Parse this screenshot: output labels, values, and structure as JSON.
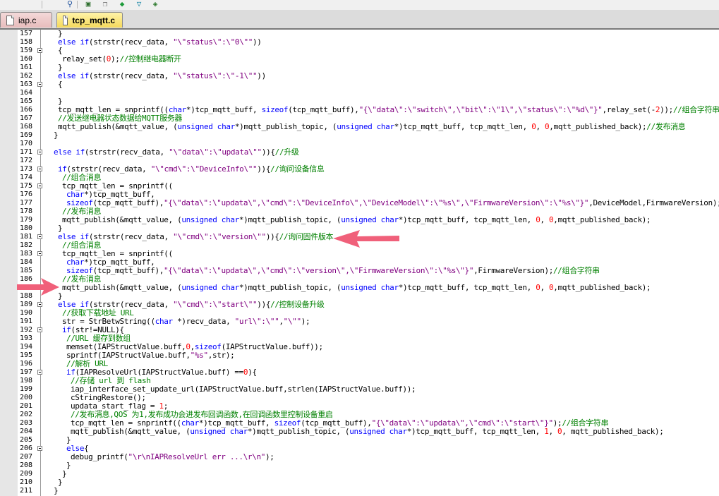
{
  "toolbar": {
    "buttons": [
      {
        "name": "find-in-files-icon",
        "glyph": "⚲"
      },
      {
        "name": "window-icon",
        "glyph": "▣"
      },
      {
        "name": "copy-window-icon",
        "glyph": "❐"
      },
      {
        "name": "diamond-download-icon",
        "glyph": "◆"
      },
      {
        "name": "funnel-icon",
        "glyph": "▽"
      },
      {
        "name": "flow-diagram-icon",
        "glyph": "◈"
      }
    ]
  },
  "tabs": [
    {
      "label": "iap.c",
      "active": false
    },
    {
      "label": "tcp_mqtt.c",
      "active": true
    }
  ],
  "colors": {
    "keyword": "#0000ff",
    "string": "#800080",
    "comment": "#008000",
    "number": "#ff0000",
    "arrow": "#f0607a"
  },
  "editor": {
    "lines": [
      {
        "n": "157",
        "indent": 7,
        "fold": null,
        "segs": [
          [
            "p",
            "}"
          ]
        ]
      },
      {
        "n": "158",
        "indent": 7,
        "fold": null,
        "segs": [
          [
            "k",
            "else if"
          ],
          [
            "p",
            "(strstr(recv_data, "
          ],
          [
            "s",
            "\"\\\"status\\\":\\\"0\\\"\""
          ],
          [
            "p",
            "))"
          ]
        ]
      },
      {
        "n": "159",
        "indent": 7,
        "fold": "open",
        "segs": [
          [
            "p",
            "{"
          ]
        ]
      },
      {
        "n": "160",
        "indent": 8,
        "fold": null,
        "segs": [
          [
            "p",
            "relay_set("
          ],
          [
            "n",
            "0"
          ],
          [
            "p",
            ");"
          ],
          [
            "c",
            "//控制继电器断开"
          ]
        ]
      },
      {
        "n": "161",
        "indent": 7,
        "fold": null,
        "segs": [
          [
            "p",
            "}"
          ]
        ]
      },
      {
        "n": "162",
        "indent": 7,
        "fold": null,
        "segs": [
          [
            "k",
            "else if"
          ],
          [
            "p",
            "(strstr(recv_data, "
          ],
          [
            "s",
            "\"\\\"status\\\":\\\"-1\\\"\""
          ],
          [
            "p",
            "))"
          ]
        ]
      },
      {
        "n": "163",
        "indent": 7,
        "fold": "open",
        "segs": [
          [
            "p",
            "{"
          ]
        ]
      },
      {
        "n": "164",
        "indent": 7,
        "fold": null,
        "segs": []
      },
      {
        "n": "165",
        "indent": 7,
        "fold": null,
        "segs": [
          [
            "p",
            "}"
          ]
        ]
      },
      {
        "n": "166",
        "indent": 7,
        "fold": null,
        "segs": [
          [
            "p",
            "tcp_mqtt_len = snprintf(("
          ],
          [
            "k",
            "char"
          ],
          [
            "p",
            "*)tcp_mqtt_buff, "
          ],
          [
            "k",
            "sizeof"
          ],
          [
            "p",
            "(tcp_mqtt_buff),"
          ],
          [
            "s",
            "\"{\\\"data\\\":\\\"switch\\\",\\\"bit\\\":\\\"1\\\",\\\"status\\\":\\\"%d\\\"}\""
          ],
          [
            "p",
            ",relay_set(-"
          ],
          [
            "n",
            "2"
          ],
          [
            "p",
            "));"
          ],
          [
            "c",
            "//组合字符串"
          ]
        ]
      },
      {
        "n": "167",
        "indent": 7,
        "fold": null,
        "segs": [
          [
            "c",
            "//发送继电器状态数据给MQTT服务器"
          ]
        ]
      },
      {
        "n": "168",
        "indent": 7,
        "fold": null,
        "segs": [
          [
            "p",
            "mqtt_publish(&mqtt_value, ("
          ],
          [
            "k",
            "unsigned char"
          ],
          [
            "p",
            "*)mqtt_publish_topic, ("
          ],
          [
            "k",
            "unsigned char"
          ],
          [
            "p",
            "*)tcp_mqtt_buff, tcp_mqtt_len, "
          ],
          [
            "n",
            "0"
          ],
          [
            "p",
            ", "
          ],
          [
            "n",
            "0"
          ],
          [
            "p",
            ",mqtt_published_back);"
          ],
          [
            "c",
            "//发布消息"
          ]
        ]
      },
      {
        "n": "169",
        "indent": 6,
        "fold": null,
        "segs": [
          [
            "p",
            "}"
          ]
        ]
      },
      {
        "n": "170",
        "indent": 6,
        "fold": null,
        "segs": []
      },
      {
        "n": "171",
        "indent": 6,
        "fold": "open",
        "segs": [
          [
            "k",
            "else if"
          ],
          [
            "p",
            "(strstr(recv_data, "
          ],
          [
            "s",
            "\"\\\"data\\\":\\\"updata\\\"\""
          ],
          [
            "p",
            "))"
          ],
          [
            "p",
            "{"
          ],
          [
            "c",
            "//升级"
          ]
        ]
      },
      {
        "n": "172",
        "indent": 6,
        "fold": null,
        "segs": []
      },
      {
        "n": "173",
        "indent": 7,
        "fold": "open",
        "segs": [
          [
            "k",
            "if"
          ],
          [
            "p",
            "(strstr(recv_data, "
          ],
          [
            "s",
            "\"\\\"cmd\\\":\\\"DeviceInfo\\\"\""
          ],
          [
            "p",
            "))"
          ],
          [
            "p",
            "{"
          ],
          [
            "c",
            "//询问设备信息"
          ]
        ]
      },
      {
        "n": "174",
        "indent": 8,
        "fold": null,
        "segs": [
          [
            "c",
            "//组合消息"
          ]
        ]
      },
      {
        "n": "175",
        "indent": 8,
        "fold": "open",
        "segs": [
          [
            "p",
            "tcp_mqtt_len = snprintf(("
          ]
        ]
      },
      {
        "n": "176",
        "indent": 9,
        "fold": null,
        "segs": [
          [
            "k",
            "char"
          ],
          [
            "p",
            "*)tcp_mqtt_buff,"
          ]
        ]
      },
      {
        "n": "177",
        "indent": 9,
        "fold": null,
        "segs": [
          [
            "k",
            "sizeof"
          ],
          [
            "p",
            "(tcp_mqtt_buff),"
          ],
          [
            "s",
            "\"{\\\"data\\\":\\\"updata\\\",\\\"cmd\\\":\\\"DeviceInfo\\\",\\\"DeviceModel\\\":\\\"%s\\\",\\\"FirmwareVersion\\\":\\\"%s\\\"}\""
          ],
          [
            "p",
            ",DeviceModel,FirmwareVersion);"
          ],
          [
            "c",
            "//组"
          ]
        ]
      },
      {
        "n": "178",
        "indent": 8,
        "fold": null,
        "segs": [
          [
            "c",
            "//发布消息"
          ]
        ]
      },
      {
        "n": "179",
        "indent": 8,
        "fold": null,
        "segs": [
          [
            "p",
            "mqtt_publish(&mqtt_value, ("
          ],
          [
            "k",
            "unsigned char"
          ],
          [
            "p",
            "*)mqtt_publish_topic, ("
          ],
          [
            "k",
            "unsigned char"
          ],
          [
            "p",
            "*)tcp_mqtt_buff, tcp_mqtt_len, "
          ],
          [
            "n",
            "0"
          ],
          [
            "p",
            ", "
          ],
          [
            "n",
            "0"
          ],
          [
            "p",
            ",mqtt_published_back);"
          ]
        ]
      },
      {
        "n": "180",
        "indent": 7,
        "fold": null,
        "segs": [
          [
            "p",
            "}"
          ]
        ]
      },
      {
        "n": "181",
        "indent": 7,
        "fold": "open",
        "segs": [
          [
            "k",
            "else if"
          ],
          [
            "p",
            "(strstr(recv_data, "
          ],
          [
            "s",
            "\"\\\"cmd\\\":\\\"version\\\"\""
          ],
          [
            "p",
            "))"
          ],
          [
            "p",
            "{"
          ],
          [
            "c",
            "//询问固件版本"
          ]
        ]
      },
      {
        "n": "182",
        "indent": 8,
        "fold": null,
        "segs": [
          [
            "c",
            "//组合消息"
          ]
        ]
      },
      {
        "n": "183",
        "indent": 8,
        "fold": "open",
        "segs": [
          [
            "p",
            "tcp_mqtt_len = snprintf(("
          ]
        ]
      },
      {
        "n": "184",
        "indent": 9,
        "fold": null,
        "segs": [
          [
            "k",
            "char"
          ],
          [
            "p",
            "*)tcp_mqtt_buff,"
          ]
        ]
      },
      {
        "n": "185",
        "indent": 9,
        "fold": null,
        "segs": [
          [
            "k",
            "sizeof"
          ],
          [
            "p",
            "(tcp_mqtt_buff),"
          ],
          [
            "s",
            "\"{\\\"data\\\":\\\"updata\\\",\\\"cmd\\\":\\\"version\\\",\\\"FirmwareVersion\\\":\\\"%s\\\"}\""
          ],
          [
            "p",
            ",FirmwareVersion);"
          ],
          [
            "c",
            "//组合字符串"
          ]
        ]
      },
      {
        "n": "186",
        "indent": 8,
        "fold": null,
        "segs": [
          [
            "c",
            "//发布消息"
          ]
        ]
      },
      {
        "n": "187",
        "indent": 8,
        "fold": null,
        "segs": [
          [
            "p",
            "mqtt_publish(&mqtt_value, ("
          ],
          [
            "k",
            "unsigned char"
          ],
          [
            "p",
            "*)mqtt_publish_topic, ("
          ],
          [
            "k",
            "unsigned char"
          ],
          [
            "p",
            "*)tcp_mqtt_buff, tcp_mqtt_len, "
          ],
          [
            "n",
            "0"
          ],
          [
            "p",
            ", "
          ],
          [
            "n",
            "0"
          ],
          [
            "p",
            ",mqtt_published_back);"
          ]
        ]
      },
      {
        "n": "188",
        "indent": 7,
        "fold": null,
        "segs": [
          [
            "p",
            "}"
          ]
        ]
      },
      {
        "n": "189",
        "indent": 7,
        "fold": "open",
        "segs": [
          [
            "k",
            "else if"
          ],
          [
            "p",
            "(strstr(recv_data, "
          ],
          [
            "s",
            "\"\\\"cmd\\\":\\\"start\\\"\""
          ],
          [
            "p",
            "))"
          ],
          [
            "p",
            "{"
          ],
          [
            "c",
            "//控制设备升级"
          ]
        ]
      },
      {
        "n": "190",
        "indent": 8,
        "fold": null,
        "segs": [
          [
            "c",
            "//获取下载地址 URL"
          ]
        ]
      },
      {
        "n": "191",
        "indent": 8,
        "fold": null,
        "segs": [
          [
            "p",
            "str = StrBetwString(("
          ],
          [
            "k",
            "char"
          ],
          [
            "p",
            " *)recv_data, "
          ],
          [
            "s",
            "\"url\\\":\\\"\""
          ],
          [
            "p",
            ","
          ],
          [
            "s",
            "\"\\\"\""
          ],
          [
            "p",
            ");"
          ]
        ]
      },
      {
        "n": "192",
        "indent": 8,
        "fold": "open",
        "segs": [
          [
            "k",
            "if"
          ],
          [
            "p",
            "(str!=NULL){"
          ]
        ]
      },
      {
        "n": "193",
        "indent": 9,
        "fold": null,
        "segs": [
          [
            "c",
            "//URL 缓存到数组"
          ]
        ]
      },
      {
        "n": "194",
        "indent": 9,
        "fold": null,
        "segs": [
          [
            "p",
            "memset(IAPStructValue.buff,"
          ],
          [
            "n",
            "0"
          ],
          [
            "p",
            ","
          ],
          [
            "k",
            "sizeof"
          ],
          [
            "p",
            "(IAPStructValue.buff));"
          ]
        ]
      },
      {
        "n": "195",
        "indent": 9,
        "fold": null,
        "segs": [
          [
            "p",
            "sprintf(IAPStructValue.buff,"
          ],
          [
            "s",
            "\"%s\""
          ],
          [
            "p",
            ",str);"
          ]
        ]
      },
      {
        "n": "196",
        "indent": 9,
        "fold": null,
        "segs": [
          [
            "c",
            "//解析 URL"
          ]
        ]
      },
      {
        "n": "197",
        "indent": 9,
        "fold": "open",
        "segs": [
          [
            "k",
            "if"
          ],
          [
            "p",
            "(IAPResolveUrl(IAPStructValue.buff) =="
          ],
          [
            "n",
            "0"
          ],
          [
            "p",
            "){"
          ]
        ]
      },
      {
        "n": "198",
        "indent": 10,
        "fold": null,
        "segs": [
          [
            "c",
            "//存储 url 到 flash"
          ]
        ]
      },
      {
        "n": "199",
        "indent": 10,
        "fold": null,
        "segs": [
          [
            "p",
            "iap_interface_set_update_url(IAPStructValue.buff,strlen(IAPStructValue.buff));"
          ]
        ]
      },
      {
        "n": "200",
        "indent": 10,
        "fold": null,
        "segs": [
          [
            "p",
            "cStringRestore();"
          ]
        ]
      },
      {
        "n": "201",
        "indent": 10,
        "fold": null,
        "segs": [
          [
            "p",
            "updata_start_flag = "
          ],
          [
            "n",
            "1"
          ],
          [
            "p",
            ";"
          ]
        ]
      },
      {
        "n": "202",
        "indent": 10,
        "fold": null,
        "segs": [
          [
            "c",
            "//发布消息,QOS 为1,发布成功会进发布回调函数,在回调函数里控制设备重启"
          ]
        ]
      },
      {
        "n": "203",
        "indent": 10,
        "fold": null,
        "segs": [
          [
            "p",
            "tcp_mqtt_len = snprintf(("
          ],
          [
            "k",
            "char"
          ],
          [
            "p",
            "*)tcp_mqtt_buff, "
          ],
          [
            "k",
            "sizeof"
          ],
          [
            "p",
            "(tcp_mqtt_buff),"
          ],
          [
            "s",
            "\"{\\\"data\\\":\\\"updata\\\",\\\"cmd\\\":\\\"start\\\"}\""
          ],
          [
            "p",
            ");"
          ],
          [
            "c",
            "//组合字符串"
          ]
        ]
      },
      {
        "n": "204",
        "indent": 10,
        "fold": null,
        "segs": [
          [
            "p",
            "mqtt_publish(&mqtt_value, ("
          ],
          [
            "k",
            "unsigned char"
          ],
          [
            "p",
            "*)mqtt_publish_topic, ("
          ],
          [
            "k",
            "unsigned char"
          ],
          [
            "p",
            "*)tcp_mqtt_buff, tcp_mqtt_len, "
          ],
          [
            "n",
            "1"
          ],
          [
            "p",
            ", "
          ],
          [
            "n",
            "0"
          ],
          [
            "p",
            ", mqtt_published_back);"
          ]
        ]
      },
      {
        "n": "205",
        "indent": 9,
        "fold": null,
        "segs": [
          [
            "p",
            "}"
          ]
        ]
      },
      {
        "n": "206",
        "indent": 9,
        "fold": "open",
        "segs": [
          [
            "k",
            "else"
          ],
          [
            "p",
            "{"
          ]
        ]
      },
      {
        "n": "207",
        "indent": 10,
        "fold": null,
        "segs": [
          [
            "p",
            "debug_printf("
          ],
          [
            "s",
            "\"\\r\\nIAPResolveUrl err ...\\r\\n\""
          ],
          [
            "p",
            ");"
          ]
        ]
      },
      {
        "n": "208",
        "indent": 9,
        "fold": null,
        "segs": [
          [
            "p",
            "}"
          ]
        ]
      },
      {
        "n": "209",
        "indent": 8,
        "fold": null,
        "segs": [
          [
            "p",
            "}"
          ]
        ]
      },
      {
        "n": "210",
        "indent": 7,
        "fold": null,
        "segs": [
          [
            "p",
            "}"
          ]
        ]
      },
      {
        "n": "211",
        "indent": 6,
        "fold": null,
        "segs": [
          [
            "p",
            "}"
          ]
        ]
      }
    ]
  }
}
